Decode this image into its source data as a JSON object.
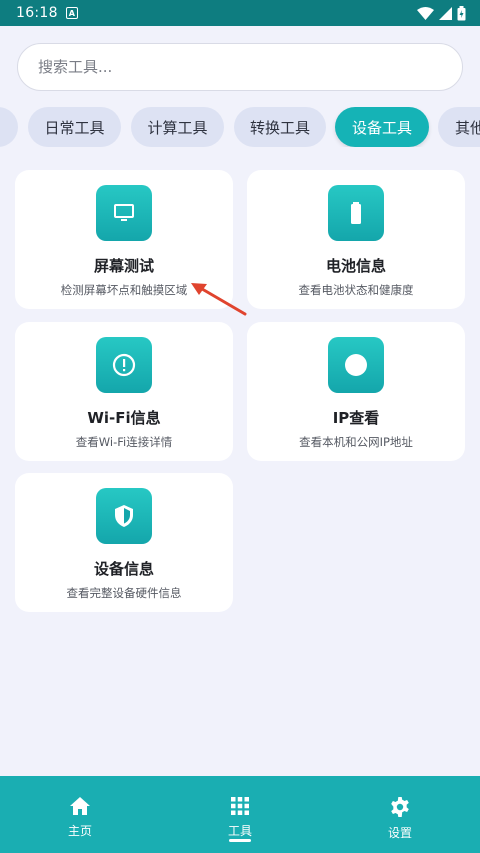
{
  "status_bar": {
    "time": "16:18",
    "badge": "A"
  },
  "search": {
    "placeholder": "搜索工具..."
  },
  "categories": [
    {
      "label": ""
    },
    {
      "label": "日常工具"
    },
    {
      "label": "计算工具"
    },
    {
      "label": "转换工具"
    },
    {
      "label": "设备工具",
      "active": true
    },
    {
      "label": "其他"
    }
  ],
  "tools": [
    {
      "title": "屏幕测试",
      "desc": "检测屏幕坏点和触摸区域",
      "icon": "monitor-icon"
    },
    {
      "title": "电池信息",
      "desc": "查看电池状态和健康度",
      "icon": "battery-icon"
    },
    {
      "title": "Wi-Fi信息",
      "desc": "查看Wi-Fi连接详情",
      "icon": "info-circle-icon"
    },
    {
      "title": "IP查看",
      "desc": "查看本机和公网IP地址",
      "icon": "dot-icon"
    },
    {
      "title": "设备信息",
      "desc": "查看完整设备硬件信息",
      "icon": "shield-icon"
    }
  ],
  "bottom_nav": [
    {
      "label": "主页",
      "icon": "home-icon"
    },
    {
      "label": "工具",
      "icon": "grid-icon",
      "active": true
    },
    {
      "label": "设置",
      "icon": "gear-icon"
    }
  ],
  "colors": {
    "accent": "#15b3b6",
    "status_bar": "#0e7d80",
    "nav": "#1aaeb2",
    "arrow": "#e0442e"
  }
}
